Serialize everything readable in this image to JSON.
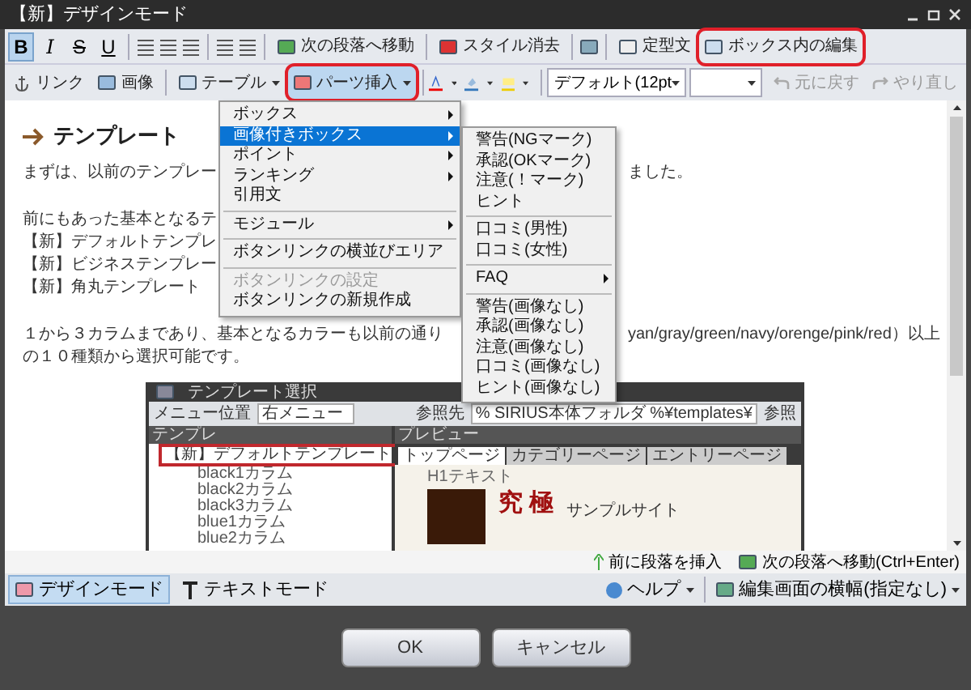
{
  "window": {
    "title": "【新】デザインモード"
  },
  "toolbar_1": {
    "format_buttons": [
      {
        "label": "B",
        "selected": true
      },
      {
        "label": "I",
        "selected": false
      },
      {
        "label": "S",
        "selected": false
      },
      {
        "label": "U",
        "selected": false
      }
    ],
    "next_paragraph": "次の段落へ移動",
    "clear_style": "スタイル消去",
    "snippet": "定型文",
    "box_edit": {
      "label": "ボックス内の編集",
      "highlighted": true
    }
  },
  "toolbar_2": {
    "link": "リンク",
    "image": "画像",
    "table": "テーブル",
    "insert_parts": {
      "label": "パーツ挿入",
      "highlighted": true,
      "expanded": true
    },
    "font_size": "デフォルト(12pt",
    "undo": {
      "label": "元に戻す",
      "disabled": true
    },
    "redo": {
      "label": "やり直し",
      "disabled": true
    }
  },
  "content": {
    "heading": "テンプレート",
    "paragraphs": [
      [
        {
          "text": "まずは、以前のテンプレー",
          "after_menu": "ました。"
        }
      ],
      [
        {
          "text": "前にもあった基本となるテ"
        },
        {
          "text": "【新】デフォルトテンプレ"
        },
        {
          "text": "【新】ビジネステンプレー"
        },
        {
          "text": "【新】角丸テンプレート"
        }
      ],
      [
        {
          "text": "１から３カラムまであり、基本となるカラーも以前の通り",
          "after_menu": "yan/gray/green/navy/orenge/pink/red）以上"
        },
        {
          "text": "の１０種類から選択可能です。"
        }
      ]
    ],
    "screenshot": {
      "title": "テンプレート選択",
      "menu_position_label": "メニュー位置",
      "menu_position": "右メニュー",
      "ref_label": "参照先",
      "ref_path": "% SIRIUS本体フォルダ %¥templates¥",
      "ref_button": "参照",
      "tree_title": "テンプレ",
      "preview_title": "プレビュー",
      "tree": [
        {
          "label": "【新】デフォルトテンプレート",
          "highlighted": true,
          "children": [
            {
              "label": "black1カラム"
            },
            {
              "label": "black2カラム"
            },
            {
              "label": "black3カラム"
            },
            {
              "label": "blue1カラム"
            },
            {
              "label": "blue2カラム"
            }
          ]
        }
      ],
      "tabs": [
        {
          "label": "トップページ",
          "selected": true
        },
        {
          "label": "カテゴリーページ",
          "selected": false
        },
        {
          "label": "エントリーページ",
          "selected": false
        }
      ],
      "h1": "H1テキスト",
      "banner_title": "究 極",
      "banner_sub": "サンプルサイト"
    }
  },
  "parts_menu": [
    {
      "kind": "item",
      "label": "ボックス",
      "submenu": true,
      "selected": false,
      "disabled": false
    },
    {
      "kind": "item",
      "label": "画像付きボックス",
      "submenu": true,
      "selected": true,
      "disabled": false
    },
    {
      "kind": "item",
      "label": "ポイント",
      "submenu": true,
      "selected": false,
      "disabled": false
    },
    {
      "kind": "item",
      "label": "ランキング",
      "submenu": true,
      "selected": false,
      "disabled": false
    },
    {
      "kind": "item",
      "label": "引用文",
      "submenu": false,
      "selected": false,
      "disabled": false
    },
    {
      "kind": "separator"
    },
    {
      "kind": "item",
      "label": "モジュール",
      "submenu": true,
      "selected": false,
      "disabled": false
    },
    {
      "kind": "separator"
    },
    {
      "kind": "item",
      "label": "ボタンリンクの横並びエリア",
      "submenu": false,
      "selected": false,
      "disabled": false
    },
    {
      "kind": "separator"
    },
    {
      "kind": "item",
      "label": "ボタンリンクの設定",
      "submenu": false,
      "selected": false,
      "disabled": true
    },
    {
      "kind": "item",
      "label": "ボタンリンクの新規作成",
      "submenu": false,
      "selected": false,
      "disabled": false
    }
  ],
  "image_box_menu": [
    {
      "kind": "item",
      "label": "警告(NGマーク)",
      "submenu": false
    },
    {
      "kind": "item",
      "label": "承認(OKマーク)",
      "submenu": false
    },
    {
      "kind": "item",
      "label": "注意(！マーク)",
      "submenu": false
    },
    {
      "kind": "item",
      "label": "ヒント",
      "submenu": false
    },
    {
      "kind": "separator"
    },
    {
      "kind": "item",
      "label": "口コミ(男性)",
      "submenu": false
    },
    {
      "kind": "item",
      "label": "口コミ(女性)",
      "submenu": false
    },
    {
      "kind": "separator"
    },
    {
      "kind": "item",
      "label": "FAQ",
      "submenu": true
    },
    {
      "kind": "separator"
    },
    {
      "kind": "item",
      "label": "警告(画像なし)",
      "submenu": false
    },
    {
      "kind": "item",
      "label": "承認(画像なし)",
      "submenu": false
    },
    {
      "kind": "item",
      "label": "注意(画像なし)",
      "submenu": false
    },
    {
      "kind": "item",
      "label": "口コミ(画像なし)",
      "submenu": false
    },
    {
      "kind": "item",
      "label": "ヒント(画像なし)",
      "submenu": false
    }
  ],
  "paragraph_bar": {
    "insert_before": "前に段落を挿入",
    "move_next": "次の段落へ移動(Ctrl+Enter)"
  },
  "mode_bar": {
    "modes": [
      {
        "label": "デザインモード",
        "kind": "design",
        "selected": true
      },
      {
        "label": "テキストモード",
        "kind": "text",
        "selected": false
      }
    ],
    "help": "ヘルプ",
    "width": "編集画面の横幅(指定なし)"
  },
  "buttons": [
    "OK",
    "キャンセル"
  ]
}
